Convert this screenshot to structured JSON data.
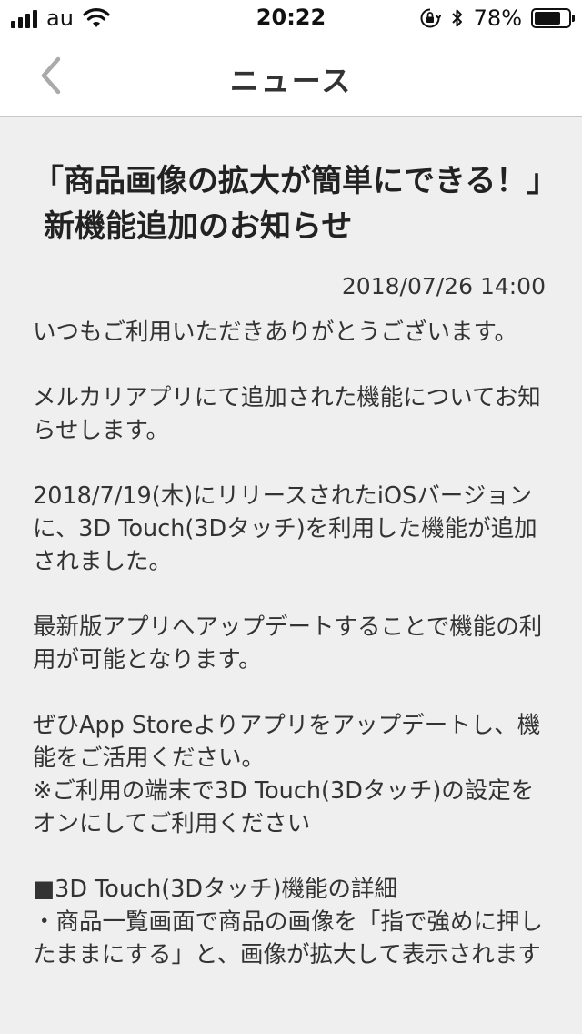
{
  "status_bar": {
    "carrier": "au",
    "time": "20:22",
    "battery_percent": "78%",
    "battery_level": 0.78,
    "icons": [
      "signal-icon",
      "wifi-icon",
      "orientation-lock-icon",
      "bluetooth-icon",
      "battery-icon"
    ]
  },
  "nav": {
    "title": "ニュース",
    "back_icon": "chevron-left-icon"
  },
  "article": {
    "title": "「商品画像の拡大が簡単にできる！」新機能追加のお知らせ",
    "date": "2018/07/26 14:00",
    "paragraphs": [
      "いつもご利用いただきありがとうございます。",
      "メルカリアプリにて追加された機能についてお知らせします。",
      "2018/7/19(木)にリリースされたiOSバージョンに、3D Touch(3Dタッチ)を利用した機能が追加されました。",
      "最新版アプリへアップデートすることで機能の利用が可能となります。",
      "ぜひApp Storeよりアプリをアップデートし、機能をご活用ください。\n※ご利用の端末で3D Touch(3Dタッチ)の設定をオンにしてご利用ください",
      "■3D Touch(3Dタッチ)機能の詳細\n・商品一覧画面で商品の画像を「指で強めに押したままにする」と、画像が拡大して表示されます"
    ]
  }
}
